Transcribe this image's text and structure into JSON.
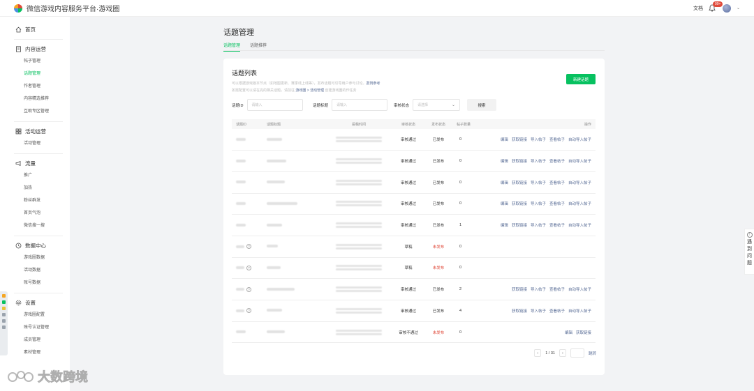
{
  "topbar": {
    "title": "微信游戏内容服务平台·游戏圈",
    "docs": "文档",
    "badge": "99+"
  },
  "sidebar": {
    "home": "首页",
    "sections": [
      {
        "title": "内容运营",
        "icon": "document-icon",
        "items": [
          "帖子管理",
          "话题管理",
          "作者管理",
          "内容精选推荐",
          "互助专区管理"
        ],
        "active": 1
      },
      {
        "title": "活动运营",
        "icon": "grid-icon",
        "items": [
          "活动管理"
        ]
      },
      {
        "title": "流量",
        "icon": "megaphone-icon",
        "items": [
          "推广",
          "加热",
          "粉丝群发",
          "首页气泡",
          "微信搜一搜"
        ]
      },
      {
        "title": "数据中心",
        "icon": "clock-icon",
        "items": [
          "游戏圈数据",
          "活动数据",
          "账号数据"
        ]
      },
      {
        "title": "设置",
        "icon": "gear-icon",
        "items": [
          "游戏圈配置",
          "账号认证管理",
          "成员管理",
          "素材管理"
        ]
      }
    ]
  },
  "page": {
    "title": "话题管理",
    "tabs": [
      "话题管理",
      "话题推荐"
    ],
    "active_tab": 0
  },
  "card": {
    "title": "话题列表",
    "desc1_a": "可以根据游戏版本节点（如地图更新、赛季线上线等），发布话题可引导用户参与讨论。",
    "desc1_link": "案例参考",
    "desc2_a": "如需配置可以请在完的相关话题，请前往",
    "desc2_link": "游戏圈 > 活动管理",
    "desc2_b": "创建游戏圈的作任务",
    "new_button": "新建话题"
  },
  "filters": {
    "id_label": "话题ID",
    "id_placeholder": "请输入",
    "title_label": "话题标题",
    "title_placeholder": "请输入",
    "status_label": "审核状态",
    "status_placeholder": "请选择",
    "search_button": "搜索"
  },
  "table": {
    "headers": [
      "话题ID",
      "话题标题",
      "投稿时间",
      "审核状态",
      "发布状态",
      "帖子数量",
      "操作"
    ],
    "rows": [
      {
        "review": "审核通过",
        "publish": "已发布",
        "count": "0",
        "q": false,
        "ops": [
          "编辑",
          "获取链接",
          "导入帖子",
          "查看帖子",
          "自动导入帖子"
        ]
      },
      {
        "review": "审核通过",
        "publish": "已发布",
        "count": "0",
        "q": false,
        "ops": [
          "编辑",
          "获取链接",
          "导入帖子",
          "查看帖子",
          "自动导入帖子"
        ]
      },
      {
        "review": "审核通过",
        "publish": "已发布",
        "count": "0",
        "q": false,
        "ops": [
          "编辑",
          "获取链接",
          "导入帖子",
          "查看帖子",
          "自动导入帖子"
        ]
      },
      {
        "review": "审核通过",
        "publish": "已发布",
        "count": "0",
        "q": false,
        "ops": [
          "编辑",
          "获取链接",
          "导入帖子",
          "查看帖子",
          "自动导入帖子"
        ]
      },
      {
        "review": "审核通过",
        "publish": "已发布",
        "count": "1",
        "q": false,
        "ops": [
          "编辑",
          "获取链接",
          "导入帖子",
          "查看帖子",
          "自动导入帖子"
        ]
      },
      {
        "review": "草稿",
        "publish": "未发布",
        "count": "0",
        "q": true,
        "ops": []
      },
      {
        "review": "草稿",
        "publish": "未发布",
        "count": "0",
        "q": true,
        "ops": []
      },
      {
        "review": "审核通过",
        "publish": "已发布",
        "count": "2",
        "q": true,
        "ops": [
          "获取链接",
          "导入帖子",
          "查看帖子",
          "自动导入帖子"
        ]
      },
      {
        "review": "审核通过",
        "publish": "已发布",
        "count": "4",
        "q": true,
        "ops": [
          "获取链接",
          "导入帖子",
          "查看帖子",
          "自动导入帖子"
        ]
      },
      {
        "review": "审核不通过",
        "publish": "未发布",
        "count": "0",
        "q": false,
        "ops": [
          "编辑",
          "获取链接"
        ]
      }
    ]
  },
  "pager": {
    "text": "1 / 31",
    "jump": "跳转"
  },
  "help": {
    "text": [
      "遇",
      "到",
      "问",
      "题"
    ]
  },
  "watermark": "大数跨境",
  "colors": {
    "accent": "#07c160",
    "link": "#576b95",
    "danger": "#e04a3a"
  }
}
